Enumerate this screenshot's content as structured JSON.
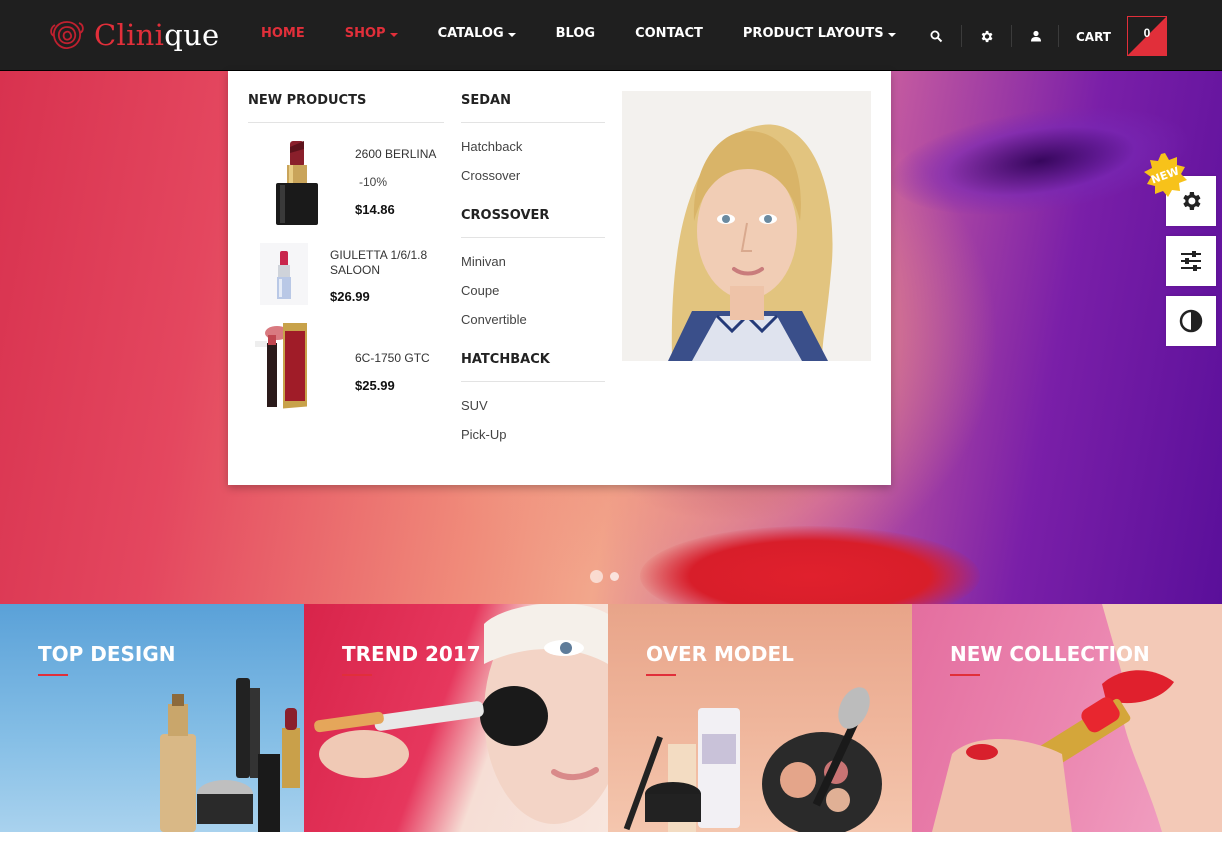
{
  "brand": {
    "name_part1": "Clini",
    "name_part2": "que",
    "accent_color": "#e12f3a"
  },
  "nav": {
    "items": [
      {
        "label": "HOME",
        "active": true,
        "dropdown": false
      },
      {
        "label": "SHOP",
        "active": true,
        "dropdown": true
      },
      {
        "label": "CATALOG",
        "active": false,
        "dropdown": true
      },
      {
        "label": "BLOG",
        "active": false,
        "dropdown": false
      },
      {
        "label": "CONTACT",
        "active": false,
        "dropdown": false
      },
      {
        "label": "PRODUCT LAYOUTS",
        "active": false,
        "dropdown": true
      }
    ],
    "icons": [
      "search-icon",
      "gear-icon",
      "user-icon"
    ],
    "cart_label": "CART",
    "cart_count": "0"
  },
  "mega_menu": {
    "new_products_title": "NEW PRODUCTS",
    "products": [
      {
        "name": "2600 BERLINA",
        "discount": "-10%",
        "price": "$14.86"
      },
      {
        "name": "GIULETTA 1/6/1.8 SALOON",
        "discount": "",
        "price": "$26.99"
      },
      {
        "name": "6C-1750 GTC",
        "discount": "",
        "price": "$25.99"
      }
    ],
    "categories": [
      {
        "title": "SEDAN",
        "links": [
          "Hatchback",
          "Crossover"
        ]
      },
      {
        "title": "CROSSOVER",
        "links": [
          "Minivan",
          "Coupe",
          "Convertible"
        ]
      },
      {
        "title": "HATCHBACK",
        "links": [
          "SUV",
          "Pick-Up"
        ]
      }
    ]
  },
  "side_widgets": {
    "badge": "NEW",
    "icons": [
      "gear-icon",
      "sliders-icon",
      "contrast-icon"
    ]
  },
  "slider": {
    "active_index": 0,
    "count": 2
  },
  "banners": [
    {
      "title": "TOP DESIGN"
    },
    {
      "title": "TREND 2017"
    },
    {
      "title": "OVER MODEL"
    },
    {
      "title": "NEW COLLECTION"
    }
  ]
}
